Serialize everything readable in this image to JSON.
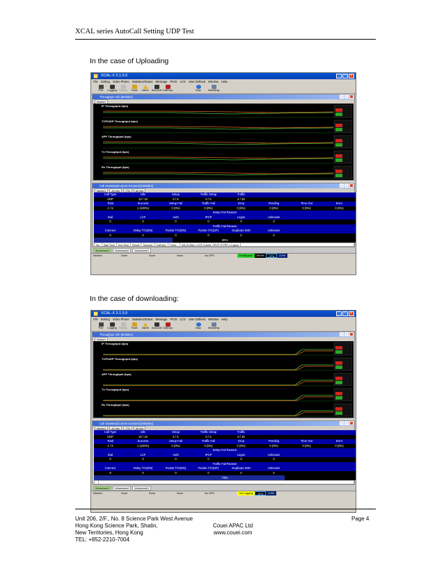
{
  "header": {
    "title": "XCAL series AutoCall Setting UDP Test"
  },
  "captions": {
    "upload": "In the case of Uploading",
    "download": "In the case of downloading:"
  },
  "app": {
    "title": "XCAL-X 3.1.5.0",
    "menu": [
      "File",
      "Setting",
      "Video Phone",
      "Statistics/Status",
      "Message",
      "PIOS",
      "LCS",
      "User Defined",
      "Window",
      "Help"
    ],
    "toolbar": [
      "Port",
      "Logging",
      "Replay",
      "Trace",
      "Alarm",
      "AutoCall",
      "CallDrop",
      "Map",
      "Inbuilding"
    ],
    "throughput_panel_title": "Throughput Info [Mobile1]",
    "mobile_tab": "Mobile1",
    "traces": [
      "IP Throughput (bps)",
      "TCP/UDP Throughput (bps)",
      "APP Throughput (bps)",
      "Tx Throughput (bps)",
      "Rx Throughput (bps)"
    ],
    "callstats_title": "Call Statistics[Current Scenario] [Mobile1]",
    "callstats_tabs": [
      "Mobile1",
      "All Info",
      "TTA",
      "All Info"
    ],
    "row1_headers": [
      "Call Type",
      "Idle",
      "Setup",
      "Traffic Setup",
      "Traffic"
    ],
    "row2_headers": [
      "Total",
      "Success",
      "Setup Fail",
      "Traffic Fail",
      "Drop",
      "Pending",
      "Time Out",
      "Error"
    ],
    "setup_fail_reason": "Setup Fail Reason",
    "row3_headers": [
      "Dial",
      "LCF",
      "Auth",
      "IPCP",
      "Logon",
      "Unknown"
    ],
    "traffic_fail_reason": "Traffic Fail Reason",
    "row4_headers": [
      "Connect",
      "Delay T/O(DN)",
      "Packet T/O(DN)",
      "Packet T/O(UP)",
      "Duplicate MIN",
      "Unknown"
    ],
    "sheet_tabs": [
      "Worksheet1",
      "Worksheet2",
      "Worksheet3"
    ],
    "status": [
      "Mobile1",
      "None",
      "None",
      "None",
      "No GPS"
    ]
  },
  "upload": {
    "row1_values": [
      "UDP",
      "10 / 10",
      "5 / 5",
      "0 / 5",
      "4 / 30"
    ],
    "row2_values": [
      "1 / 5",
      "1 (100%)",
      "0 (0%)",
      "0 (0%)",
      "0 (0%)",
      "0 (0%)",
      "0 (0%)",
      "0 (0%)"
    ],
    "row3_values": [
      "0",
      "0",
      "0",
      "0",
      "0",
      "0"
    ],
    "row4_values": [
      "0",
      "0",
      "0",
      "0",
      "0",
      "0"
    ],
    "progress": "30%",
    "progress_fraction": 0.3,
    "col_headers": [
      "No.",
      "Start Time",
      "End Time",
      "Result",
      "Scenario",
      "CallType",
      "Throu...",
      "Info (D:Dial, L:LCP, A:Auth, I:IPCP, P:PPP, L:Logon)"
    ],
    "status_flag": "FreeSpace",
    "status_val": "59.5%",
    "cpu_label": "CPU",
    "cpu_val": "2.0%"
  },
  "download": {
    "row1_values": [
      "UDP",
      "10 / 10",
      "5 / 5",
      "0 / 5",
      "9 / 30"
    ],
    "row2_values": [
      "1 / 5",
      "1 (100%)",
      "0 (0%)",
      "0 (0%)",
      "0 (0%)",
      "0 (0%)",
      "0 (0%)",
      "0 (0%)"
    ],
    "row3_values": [
      "0",
      "0",
      "0",
      "0",
      "0",
      "0"
    ],
    "row4_values": [
      "9",
      "0",
      "0",
      "0",
      "0",
      "0"
    ],
    "progress": "73%",
    "progress_fraction": 0.73,
    "status_flag": "No Logging",
    "cpu_label": "CPU",
    "cpu_val": "2.0%"
  },
  "footer": {
    "addr1": "Unit 206, 2/F., No. 8 Science Park West Avenue",
    "addr2": "Hong Kong Science Park, Shatin,",
    "addr3": "New Territories, Hong Kong",
    "tel": "TEL: +852-2210-7004",
    "company": "Couei APAC Ltd",
    "url": "www.couei.com",
    "page": "Page 4"
  }
}
